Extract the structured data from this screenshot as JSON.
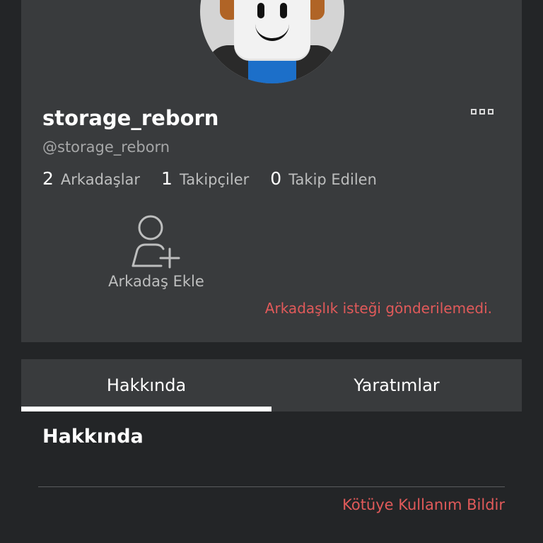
{
  "profile": {
    "display_name": "storage_reborn",
    "username": "@storage_reborn",
    "avatar_icon": "avatar-image",
    "more_icon": "more-options-icon",
    "stats": [
      {
        "count": "2",
        "label": "Arkadaşlar"
      },
      {
        "count": "1",
        "label": "Takipçiler"
      },
      {
        "count": "0",
        "label": "Takip Edilen"
      }
    ],
    "add_friend_label": "Arkadaş Ekle",
    "add_friend_icon": "add-user-icon",
    "error_message": "Arkadaşlık isteği gönderilemedi."
  },
  "tabs": [
    {
      "label": "Hakkında",
      "active": true
    },
    {
      "label": "Yaratımlar",
      "active": false
    }
  ],
  "about": {
    "title": "Hakkında",
    "report_label": "Kötüye Kullanım Bildir"
  },
  "colors": {
    "background": "#232527",
    "card": "#393b3d",
    "error": "#e15a5a",
    "text_primary": "#ffffff",
    "text_secondary": "#bdbebe"
  }
}
